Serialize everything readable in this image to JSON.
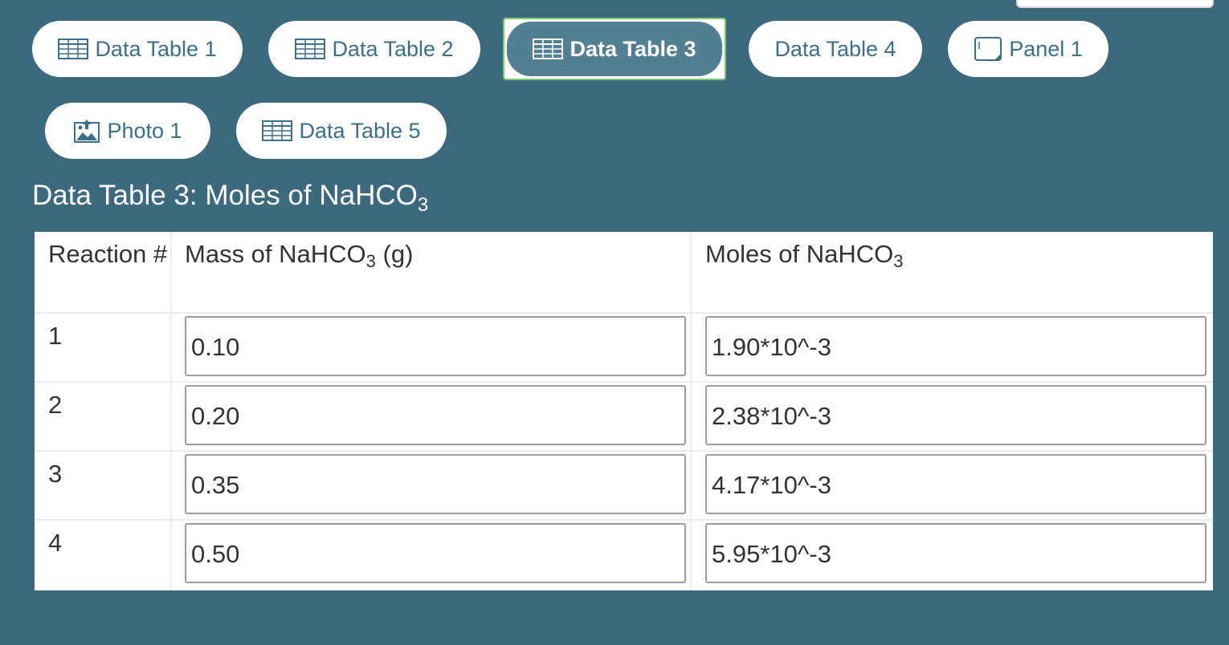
{
  "tabs": [
    {
      "label": "Data Table 1",
      "icon": "table-icon"
    },
    {
      "label": "Data Table 2",
      "icon": "table-icon"
    },
    {
      "label": "Data Table 3",
      "icon": "table-icon",
      "active": true
    },
    {
      "label": "Data Table 4"
    },
    {
      "label": "Panel 1",
      "icon": "panel-icon"
    },
    {
      "label": "Photo 1",
      "icon": "photo-upload-icon"
    },
    {
      "label": "Data Table 5",
      "icon": "table-icon"
    }
  ],
  "heading": {
    "prefix": "Data Table 3: Moles of NaHCO",
    "sub": "3"
  },
  "table": {
    "headers": {
      "reaction": "Reaction #",
      "mass_prefix": "Mass of NaHCO",
      "mass_sub": "3",
      "mass_suffix": " (g)",
      "moles_prefix": "Moles of NaHCO",
      "moles_sub": "3"
    },
    "rows": [
      {
        "reaction": "1",
        "mass": "0.10",
        "moles": "1.90*10^-3"
      },
      {
        "reaction": "2",
        "mass": "0.20",
        "moles": "2.38*10^-3"
      },
      {
        "reaction": "3",
        "mass": "0.35",
        "moles": "4.17*10^-3"
      },
      {
        "reaction": "4",
        "mass": "0.50",
        "moles": "5.95*10^-3"
      }
    ]
  },
  "colors": {
    "background": "#3d697e",
    "tab_text": "#3b6f8a",
    "active_tab": "#537f93",
    "active_border": "#7cc96d"
  }
}
